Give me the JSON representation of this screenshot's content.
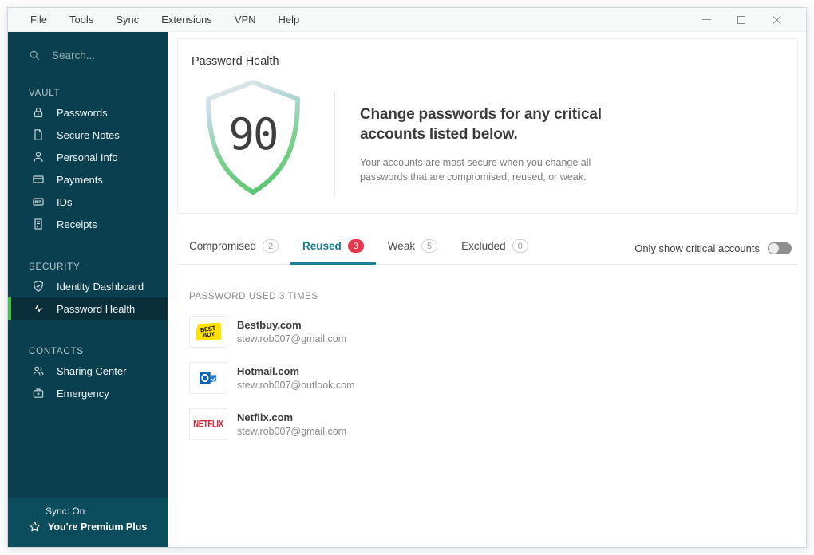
{
  "menu": {
    "items": [
      "File",
      "Tools",
      "Sync",
      "Extensions",
      "VPN",
      "Help"
    ]
  },
  "sidebar": {
    "search": {
      "placeholder": "Search..."
    },
    "sections": [
      {
        "label": "VAULT",
        "items": [
          {
            "label": "Passwords"
          },
          {
            "label": "Secure Notes"
          },
          {
            "label": "Personal Info"
          },
          {
            "label": "Payments"
          },
          {
            "label": "IDs"
          },
          {
            "label": "Receipts"
          }
        ]
      },
      {
        "label": "SECURITY",
        "items": [
          {
            "label": "Identity Dashboard"
          },
          {
            "label": "Password Health"
          }
        ]
      },
      {
        "label": "CONTACTS",
        "items": [
          {
            "label": "Sharing Center"
          },
          {
            "label": "Emergency"
          }
        ]
      }
    ],
    "footer": {
      "sync_status": "Sync: On",
      "premium_label": "You're Premium Plus"
    }
  },
  "main": {
    "health_card": {
      "title": "Password Health",
      "score": "90",
      "heading": "Change passwords for any critical accounts listed below.",
      "description": "Your accounts are most secure when you change all passwords that are compromised, reused, or weak."
    },
    "tabs": [
      {
        "label": "Compromised",
        "count": "2"
      },
      {
        "label": "Reused",
        "count": "3"
      },
      {
        "label": "Weak",
        "count": "5"
      },
      {
        "label": "Excluded",
        "count": "0"
      }
    ],
    "toggle": {
      "label": "Only show critical accounts",
      "state": "off"
    },
    "list": {
      "header": "PASSWORD USED 3 TIMES",
      "items": [
        {
          "name": "Bestbuy.com",
          "email": "stew.rob007@gmail.com",
          "logo": "bestbuy"
        },
        {
          "name": "Hotmail.com",
          "email": "stew.rob007@outlook.com",
          "logo": "outlook"
        },
        {
          "name": "Netflix.com",
          "email": "stew.rob007@gmail.com",
          "logo": "netflix"
        }
      ]
    }
  },
  "logo_text": {
    "bestbuy_line1": "BEST",
    "bestbuy_line2": "BUY",
    "netflix": "NETFLIX"
  },
  "colors": {
    "sidebar_bg": "#093f4e",
    "sidebar_footer_bg": "#0b4c5d",
    "selected_bg": "#0a2e3a",
    "accent_green": "#3ec24e",
    "active_tab_teal": "#147a90",
    "badge_red": "#e8364a",
    "bestbuy_yellow": "#ffe000",
    "netflix_red": "#d8202f",
    "outlook_blue": "#0e64b5"
  }
}
